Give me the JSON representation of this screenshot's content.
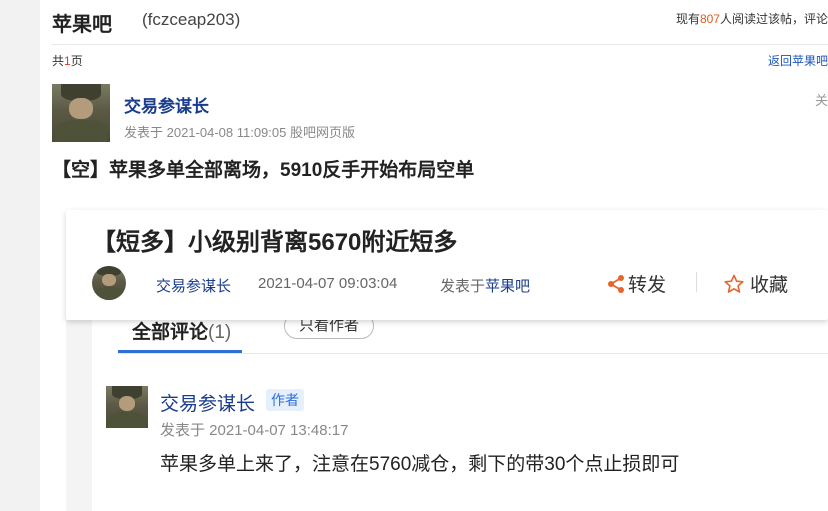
{
  "header": {
    "bar_name": "苹果吧",
    "bar_code": "(fczceap203)",
    "read_prefix": "现有",
    "read_count": "807",
    "read_suffix": "人阅读过该帖，评论"
  },
  "pagination": {
    "prefix": "共",
    "total": "1",
    "suffix": "页",
    "back_link": "返回苹果吧"
  },
  "post": {
    "author": "交易参谋长",
    "meta": "发表于 2021-04-08 11:09:05 股吧网页版",
    "edge_char": "关",
    "title": "【空】苹果多单全部离场，5910反手开始布局空单"
  },
  "embedded_article": {
    "title": "【短多】小级别背离5670附近短多",
    "author": "交易参谋长",
    "date": "2021-04-07 09:03:04",
    "published_prefix": "发表于",
    "published_in": "苹果吧",
    "share_label": "转发",
    "favorite_label": "收藏",
    "tabs": {
      "all_comments": "全部评论",
      "all_count": "(1)",
      "author_only": "只看作者"
    },
    "comment": {
      "author": "交易参谋长",
      "badge": "作者",
      "meta": "发表于 2021-04-07 13:48:17",
      "text": "苹果多单上来了，注意在5760减仓，剩下的带30个点止损即可"
    }
  },
  "colors": {
    "accent": "#2d6fd6",
    "link": "#1a3c8c",
    "highlight": "#e05a1c",
    "share_icon": "#e8642a",
    "favorite_icon": "#e8642a"
  },
  "icons": [
    "share-icon",
    "star-icon"
  ]
}
